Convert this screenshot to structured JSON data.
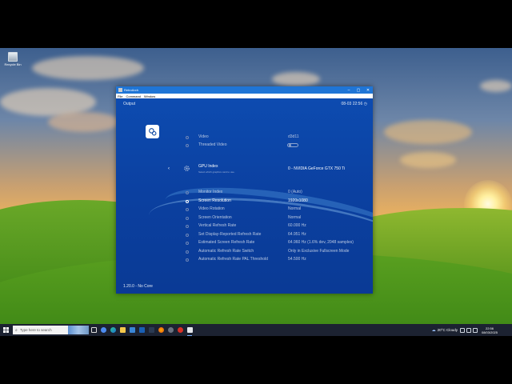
{
  "desktop": {
    "recycle_bin_label": "Recycle Bin"
  },
  "window": {
    "title": "RetroArch",
    "menu": [
      "File",
      "Command",
      "Window"
    ],
    "header_title": "Output",
    "header_clock": "08-03 22:56",
    "footer": "1.20.0 - No Core",
    "rows_top": [
      {
        "label": "Video",
        "value": "d3d11"
      },
      {
        "label": "Threaded Video",
        "value": ""
      }
    ],
    "gpu": {
      "label": "GPU Index",
      "sublabel": "Select which graphics card to use.",
      "value": "0 - NVIDIA GeForce GTX 750 Ti"
    },
    "rows": [
      {
        "label": "Monitor Index",
        "value": "0 (Auto)"
      },
      {
        "label": "Screen Resolution",
        "value": "1920x1080"
      },
      {
        "label": "Video Rotation",
        "value": "Normal"
      },
      {
        "label": "Screen Orientation",
        "value": "Normal"
      },
      {
        "label": "Vertical Refresh Rate",
        "value": "60.000 Hz"
      },
      {
        "label": "Set Display-Reported Refresh Rate",
        "value": "64.951 Hz"
      },
      {
        "label": "Estimated Screen Refresh Rate",
        "value": "64.960 Hz (1.6% dev, 2048 samples)"
      },
      {
        "label": "Automatic Refresh Rate Switch",
        "value": "Only in Exclusive Fullscreen Mode"
      },
      {
        "label": "Automatic Refresh Rate PAL Threshold",
        "value": "54.500 Hz"
      }
    ]
  },
  "taskbar": {
    "search_placeholder": "Type here to search",
    "weather": "20°C  Cloudy",
    "time": "22:56",
    "date": "08/03/2025"
  }
}
